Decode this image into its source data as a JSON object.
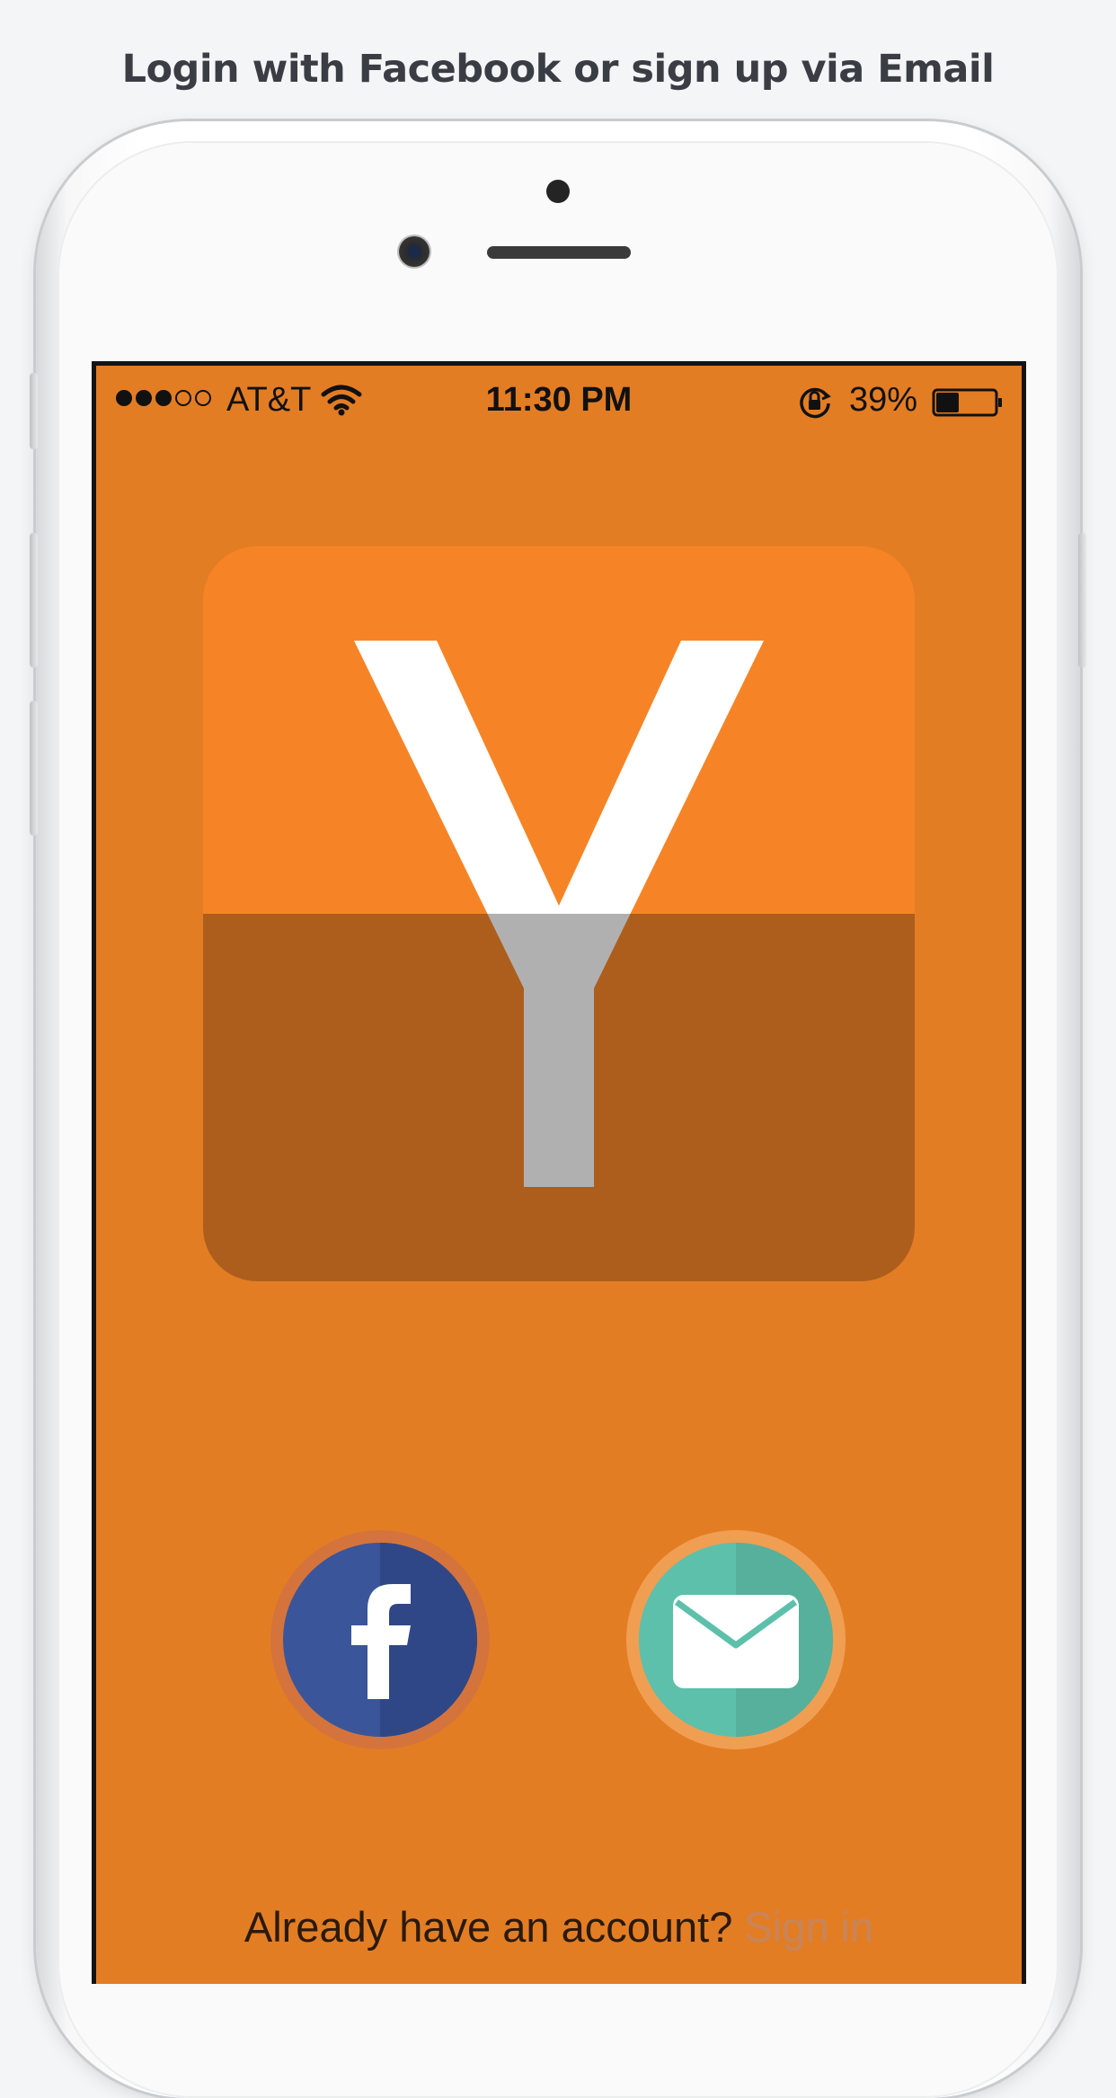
{
  "caption": "Login with Facebook or sign up via Email",
  "status_bar": {
    "carrier": "AT&T",
    "time": "11:30 PM",
    "battery_percent": "39%",
    "battery_level": 0.39,
    "signal_bars_filled": 3,
    "signal_bars_total": 5
  },
  "logo": {
    "letter": "Y",
    "top_color": "#f68426",
    "bottom_color": "#ad5e1d",
    "letter_top_color": "#ffffff",
    "letter_bottom_color": "#b1b0b1"
  },
  "buttons": {
    "facebook": {
      "icon": "facebook-icon",
      "color": "#3b559a"
    },
    "email": {
      "icon": "mail-icon",
      "color": "#5dc0aa"
    }
  },
  "footer": {
    "prompt": "Already have an account? ",
    "link": "Sign in"
  },
  "colors": {
    "screen_background": "#e37d24",
    "link": "#c7855c"
  }
}
